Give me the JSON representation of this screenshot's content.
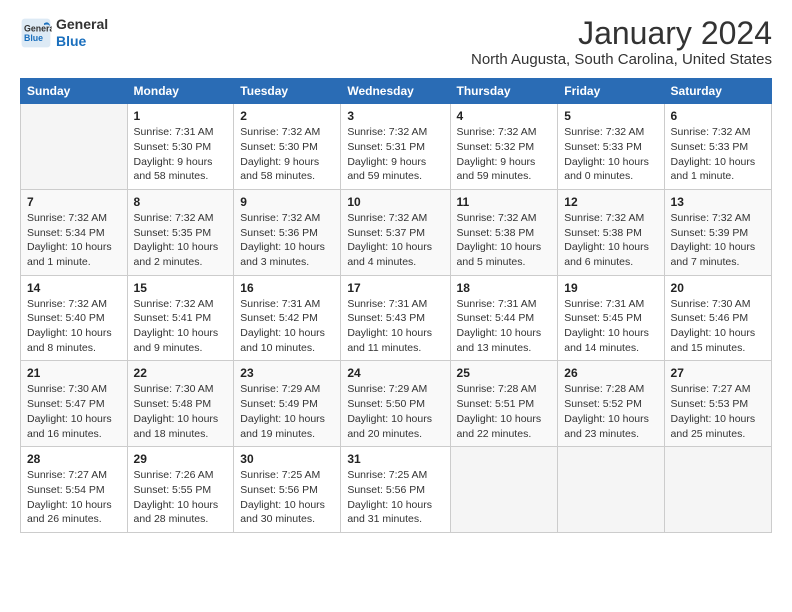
{
  "logo": {
    "line1": "General",
    "line2": "Blue"
  },
  "title": "January 2024",
  "subtitle": "North Augusta, South Carolina, United States",
  "calendar": {
    "headers": [
      "Sunday",
      "Monday",
      "Tuesday",
      "Wednesday",
      "Thursday",
      "Friday",
      "Saturday"
    ],
    "weeks": [
      [
        {
          "day": "",
          "info": ""
        },
        {
          "day": "1",
          "info": "Sunrise: 7:31 AM\nSunset: 5:30 PM\nDaylight: 9 hours\nand 58 minutes."
        },
        {
          "day": "2",
          "info": "Sunrise: 7:32 AM\nSunset: 5:30 PM\nDaylight: 9 hours\nand 58 minutes."
        },
        {
          "day": "3",
          "info": "Sunrise: 7:32 AM\nSunset: 5:31 PM\nDaylight: 9 hours\nand 59 minutes."
        },
        {
          "day": "4",
          "info": "Sunrise: 7:32 AM\nSunset: 5:32 PM\nDaylight: 9 hours\nand 59 minutes."
        },
        {
          "day": "5",
          "info": "Sunrise: 7:32 AM\nSunset: 5:33 PM\nDaylight: 10 hours\nand 0 minutes."
        },
        {
          "day": "6",
          "info": "Sunrise: 7:32 AM\nSunset: 5:33 PM\nDaylight: 10 hours\nand 1 minute."
        }
      ],
      [
        {
          "day": "7",
          "info": "Sunrise: 7:32 AM\nSunset: 5:34 PM\nDaylight: 10 hours\nand 1 minute."
        },
        {
          "day": "8",
          "info": "Sunrise: 7:32 AM\nSunset: 5:35 PM\nDaylight: 10 hours\nand 2 minutes."
        },
        {
          "day": "9",
          "info": "Sunrise: 7:32 AM\nSunset: 5:36 PM\nDaylight: 10 hours\nand 3 minutes."
        },
        {
          "day": "10",
          "info": "Sunrise: 7:32 AM\nSunset: 5:37 PM\nDaylight: 10 hours\nand 4 minutes."
        },
        {
          "day": "11",
          "info": "Sunrise: 7:32 AM\nSunset: 5:38 PM\nDaylight: 10 hours\nand 5 minutes."
        },
        {
          "day": "12",
          "info": "Sunrise: 7:32 AM\nSunset: 5:38 PM\nDaylight: 10 hours\nand 6 minutes."
        },
        {
          "day": "13",
          "info": "Sunrise: 7:32 AM\nSunset: 5:39 PM\nDaylight: 10 hours\nand 7 minutes."
        }
      ],
      [
        {
          "day": "14",
          "info": "Sunrise: 7:32 AM\nSunset: 5:40 PM\nDaylight: 10 hours\nand 8 minutes."
        },
        {
          "day": "15",
          "info": "Sunrise: 7:32 AM\nSunset: 5:41 PM\nDaylight: 10 hours\nand 9 minutes."
        },
        {
          "day": "16",
          "info": "Sunrise: 7:31 AM\nSunset: 5:42 PM\nDaylight: 10 hours\nand 10 minutes."
        },
        {
          "day": "17",
          "info": "Sunrise: 7:31 AM\nSunset: 5:43 PM\nDaylight: 10 hours\nand 11 minutes."
        },
        {
          "day": "18",
          "info": "Sunrise: 7:31 AM\nSunset: 5:44 PM\nDaylight: 10 hours\nand 13 minutes."
        },
        {
          "day": "19",
          "info": "Sunrise: 7:31 AM\nSunset: 5:45 PM\nDaylight: 10 hours\nand 14 minutes."
        },
        {
          "day": "20",
          "info": "Sunrise: 7:30 AM\nSunset: 5:46 PM\nDaylight: 10 hours\nand 15 minutes."
        }
      ],
      [
        {
          "day": "21",
          "info": "Sunrise: 7:30 AM\nSunset: 5:47 PM\nDaylight: 10 hours\nand 16 minutes."
        },
        {
          "day": "22",
          "info": "Sunrise: 7:30 AM\nSunset: 5:48 PM\nDaylight: 10 hours\nand 18 minutes."
        },
        {
          "day": "23",
          "info": "Sunrise: 7:29 AM\nSunset: 5:49 PM\nDaylight: 10 hours\nand 19 minutes."
        },
        {
          "day": "24",
          "info": "Sunrise: 7:29 AM\nSunset: 5:50 PM\nDaylight: 10 hours\nand 20 minutes."
        },
        {
          "day": "25",
          "info": "Sunrise: 7:28 AM\nSunset: 5:51 PM\nDaylight: 10 hours\nand 22 minutes."
        },
        {
          "day": "26",
          "info": "Sunrise: 7:28 AM\nSunset: 5:52 PM\nDaylight: 10 hours\nand 23 minutes."
        },
        {
          "day": "27",
          "info": "Sunrise: 7:27 AM\nSunset: 5:53 PM\nDaylight: 10 hours\nand 25 minutes."
        }
      ],
      [
        {
          "day": "28",
          "info": "Sunrise: 7:27 AM\nSunset: 5:54 PM\nDaylight: 10 hours\nand 26 minutes."
        },
        {
          "day": "29",
          "info": "Sunrise: 7:26 AM\nSunset: 5:55 PM\nDaylight: 10 hours\nand 28 minutes."
        },
        {
          "day": "30",
          "info": "Sunrise: 7:25 AM\nSunset: 5:56 PM\nDaylight: 10 hours\nand 30 minutes."
        },
        {
          "day": "31",
          "info": "Sunrise: 7:25 AM\nSunset: 5:56 PM\nDaylight: 10 hours\nand 31 minutes."
        },
        {
          "day": "",
          "info": ""
        },
        {
          "day": "",
          "info": ""
        },
        {
          "day": "",
          "info": ""
        }
      ]
    ]
  }
}
